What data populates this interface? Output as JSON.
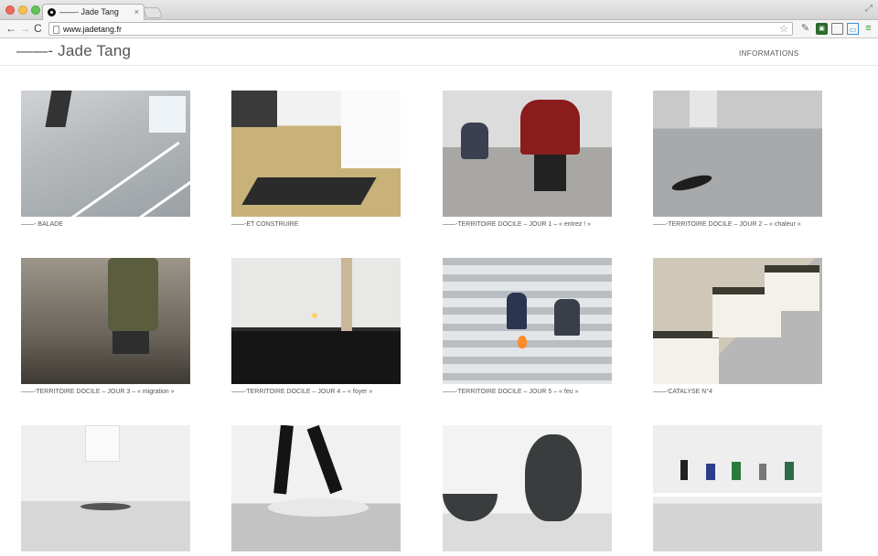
{
  "browser": {
    "tab_title": "——- Jade Tang",
    "tab_close": "×",
    "url": "www.jadetang.fr",
    "back": "←",
    "forward": "→",
    "reload": "C",
    "star": "☆",
    "resize": "⤢"
  },
  "site": {
    "logo": "——- Jade Tang",
    "nav_informations": "INFORMATIONS"
  },
  "gallery": [
    {
      "caption": "——- BALADE"
    },
    {
      "caption": "——-ET CONSTRUIRE"
    },
    {
      "caption": "——-TERRITOIRE DOCILE – JOUR 1 – « entrez ! »"
    },
    {
      "caption": "——-TERRITOIRE DOCILE – JOUR 2 – « chaleur »"
    },
    {
      "caption": "——-TERRITOIRE DOCILE – JOUR 3 – « migration »"
    },
    {
      "caption": "——-TERRITOIRE DOCILE – JOUR 4 – « foyer »"
    },
    {
      "caption": "——-TERRITOIRE DOCILE – JOUR 5 – « feu »"
    },
    {
      "caption": "——-CATALYSE N°4"
    },
    {
      "caption": ""
    },
    {
      "caption": ""
    },
    {
      "caption": ""
    },
    {
      "caption": ""
    }
  ],
  "icons": {
    "extension_1": "puzzle-icon",
    "extension_2": "badge-icon",
    "extension_3": "window-icon",
    "extension_4": "crop-icon",
    "menu": "hamburger-menu-icon"
  }
}
